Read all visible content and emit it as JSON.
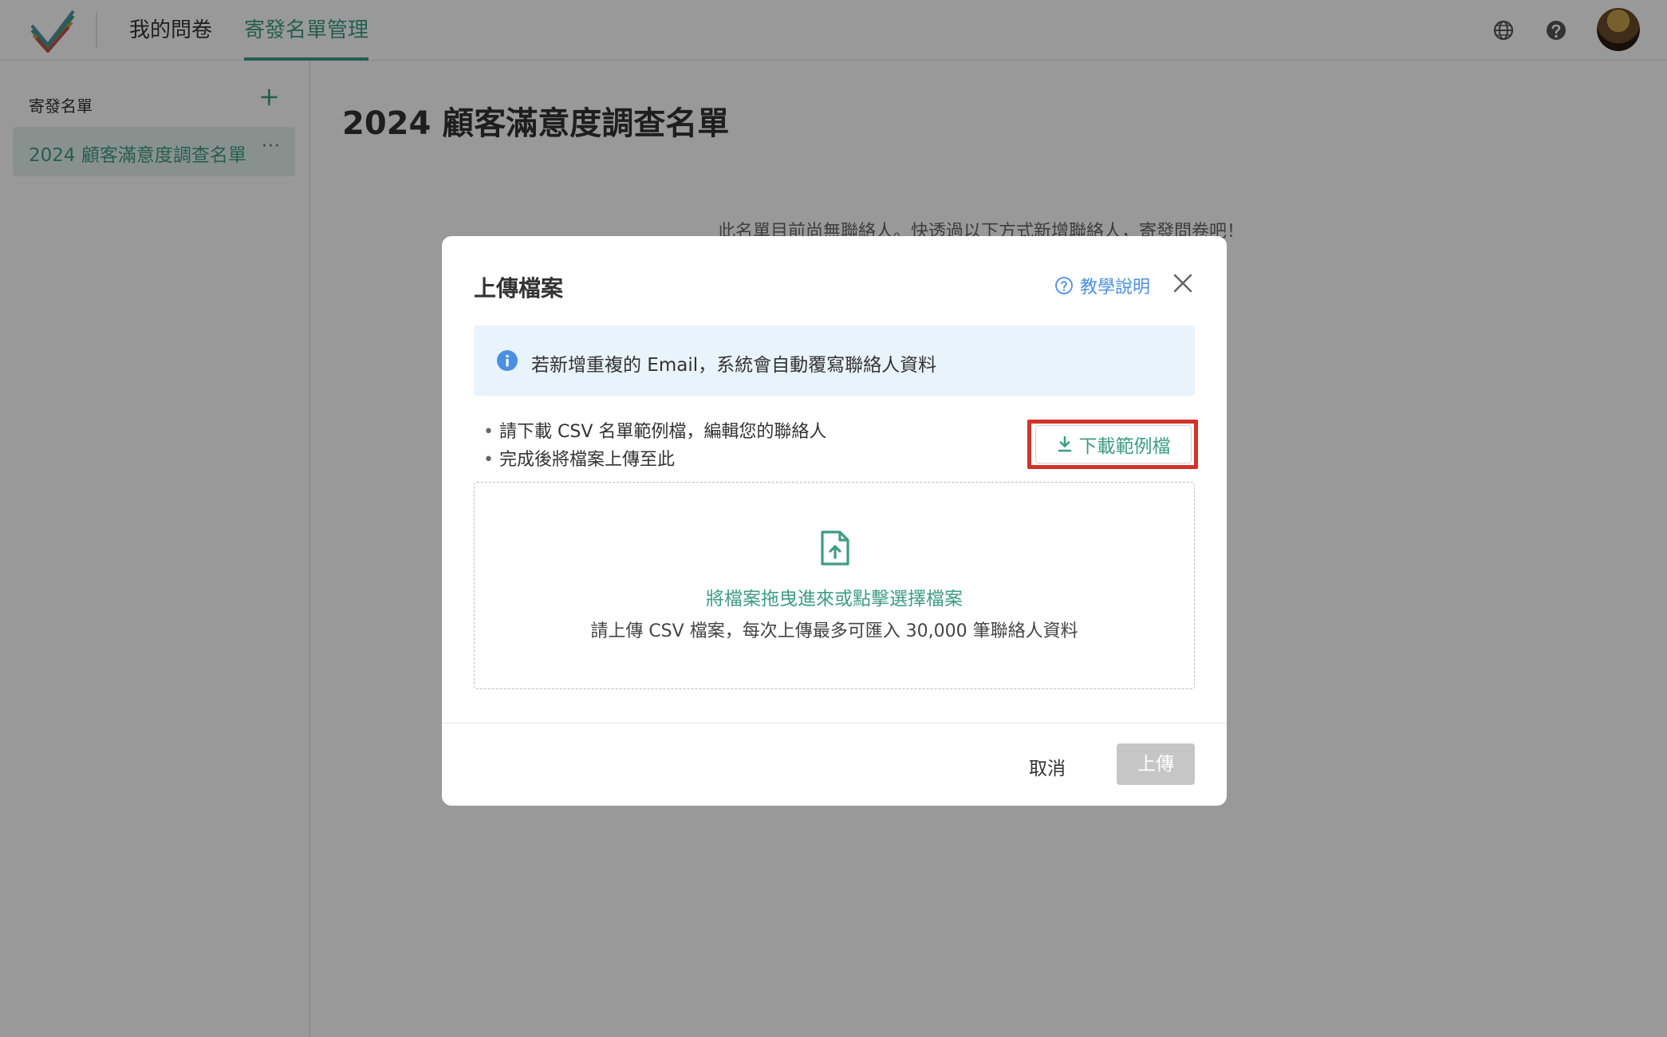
{
  "header": {
    "tabs": [
      {
        "label": "我的問卷"
      },
      {
        "label": "寄發名單管理",
        "active": true
      }
    ],
    "accent_color": "#3e9d84"
  },
  "sidebar": {
    "title": "寄發名單",
    "add_label": "+",
    "items": [
      {
        "label": "2024 顧客滿意度調查名單",
        "more_label": "···",
        "selected": true
      }
    ]
  },
  "main": {
    "title": "2024 顧客滿意度調查名單",
    "empty_message": "此名單目前尚無聯絡人。快透過以下方式新增聯絡人，寄發問卷吧！"
  },
  "modal": {
    "title": "上傳檔案",
    "help_label": "教學說明",
    "info_text": "若新增重複的 Email，系統會自動覆寫聯絡人資料",
    "instructions": [
      "請下載 CSV 名單範例檔，編輯您的聯絡人",
      "完成後將檔案上傳至此"
    ],
    "download_label": "下載範例檔",
    "dropzone": {
      "main_text": "將檔案拖曳進來或點擊選擇檔案",
      "sub_text": "請上傳 CSV 檔案，每次上傳最多可匯入 30,000 筆聯絡人資料"
    },
    "cancel_label": "取消",
    "upload_label": "上傳"
  }
}
